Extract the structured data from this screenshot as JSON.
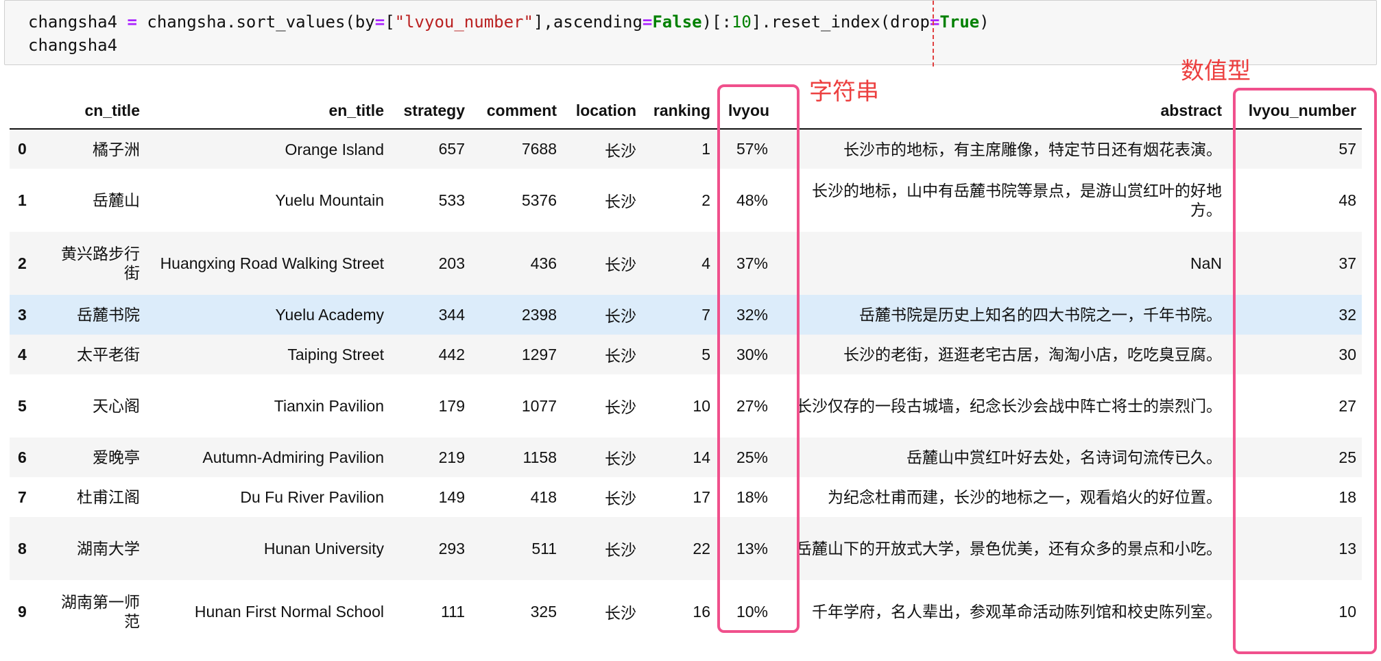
{
  "code": {
    "line1": {
      "var": "changsha4",
      "eq": "=",
      "call1": "changsha.sort_values(by",
      "eq2": "=",
      "bracket_open": "[",
      "str": "\"lvyou_number\"",
      "after_str": "],ascending",
      "eq3": "=",
      "kw_false": "False",
      "slice_open": ")[:",
      "num": "10",
      "reset": "].reset_index(drop",
      "eq4": "=",
      "kw_true": "True",
      "close": ")"
    },
    "line2": "changsha4"
  },
  "annotations": {
    "string_label": "字符串",
    "numeric_label": "数值型",
    "color": "#f0508c"
  },
  "table": {
    "headers": {
      "index": "",
      "cn_title": "cn_title",
      "en_title": "en_title",
      "strategy": "strategy",
      "comment": "comment",
      "location": "location",
      "ranking": "ranking",
      "lvyou": "lvyou",
      "abstract": "abstract",
      "lvyou_number": "lvyou_number"
    },
    "rows": [
      {
        "index": "0",
        "cn_title": "橘子洲",
        "en_title": "Orange Island",
        "strategy": "657",
        "comment": "7688",
        "location": "长沙",
        "ranking": "1",
        "lvyou": "57%",
        "abstract": "长沙市的地标，有主席雕像，特定节日还有烟花表演。",
        "lvyou_number": "57"
      },
      {
        "index": "1",
        "cn_title": "岳麓山",
        "en_title": "Yuelu Mountain",
        "strategy": "533",
        "comment": "5376",
        "location": "长沙",
        "ranking": "2",
        "lvyou": "48%",
        "abstract": "长沙的地标，山中有岳麓书院等景点，是游山赏红叶的好地方。",
        "lvyou_number": "48"
      },
      {
        "index": "2",
        "cn_title": "黄兴路步行街",
        "en_title": "Huangxing Road Walking Street",
        "strategy": "203",
        "comment": "436",
        "location": "长沙",
        "ranking": "4",
        "lvyou": "37%",
        "abstract": "NaN",
        "lvyou_number": "37"
      },
      {
        "index": "3",
        "cn_title": "岳麓书院",
        "en_title": "Yuelu Academy",
        "strategy": "344",
        "comment": "2398",
        "location": "长沙",
        "ranking": "7",
        "lvyou": "32%",
        "abstract": "岳麓书院是历史上知名的四大书院之一，千年书院。",
        "lvyou_number": "32"
      },
      {
        "index": "4",
        "cn_title": "太平老街",
        "en_title": "Taiping Street",
        "strategy": "442",
        "comment": "1297",
        "location": "长沙",
        "ranking": "5",
        "lvyou": "30%",
        "abstract": "长沙的老街，逛逛老宅古居，淘淘小店，吃吃臭豆腐。",
        "lvyou_number": "30"
      },
      {
        "index": "5",
        "cn_title": "天心阁",
        "en_title": "Tianxin Pavilion",
        "strategy": "179",
        "comment": "1077",
        "location": "长沙",
        "ranking": "10",
        "lvyou": "27%",
        "abstract": "长沙仅存的一段古城墙，纪念长沙会战中阵亡将士的崇烈门。",
        "lvyou_number": "27"
      },
      {
        "index": "6",
        "cn_title": "爱晚亭",
        "en_title": "Autumn-Admiring Pavilion",
        "strategy": "219",
        "comment": "1158",
        "location": "长沙",
        "ranking": "14",
        "lvyou": "25%",
        "abstract": "岳麓山中赏红叶好去处，名诗词句流传已久。",
        "lvyou_number": "25"
      },
      {
        "index": "7",
        "cn_title": "杜甫江阁",
        "en_title": "Du Fu River Pavilion",
        "strategy": "149",
        "comment": "418",
        "location": "长沙",
        "ranking": "17",
        "lvyou": "18%",
        "abstract": "为纪念杜甫而建，长沙的地标之一，观看焰火的好位置。",
        "lvyou_number": "18"
      },
      {
        "index": "8",
        "cn_title": "湖南大学",
        "en_title": "Hunan University",
        "strategy": "293",
        "comment": "511",
        "location": "长沙",
        "ranking": "22",
        "lvyou": "13%",
        "abstract": "岳麓山下的开放式大学，景色优美，还有众多的景点和小吃。",
        "lvyou_number": "13"
      },
      {
        "index": "9",
        "cn_title": "湖南第一师范",
        "en_title": "Hunan First Normal School",
        "strategy": "111",
        "comment": "325",
        "location": "长沙",
        "ranking": "16",
        "lvyou": "10%",
        "abstract": "千年学府，名人辈出，参观革命活动陈列馆和校史陈列室。",
        "lvyou_number": "10"
      }
    ],
    "hovered_row_index": "3",
    "hover_color": "#dcecfa"
  }
}
